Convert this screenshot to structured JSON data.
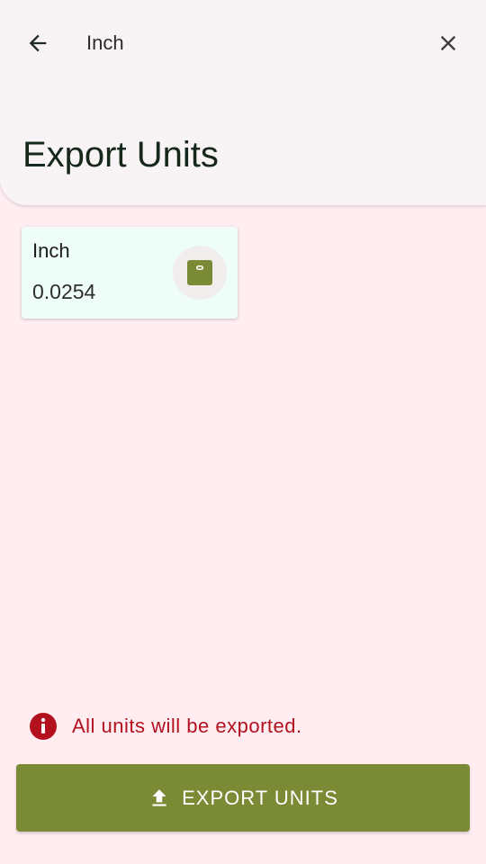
{
  "header": {
    "search_value": "Inch",
    "back_icon": "arrow-left-icon",
    "close_icon": "close-icon",
    "title": "Export Units"
  },
  "units": [
    {
      "name": "Inch",
      "value": "0.0254",
      "toggle_icon": "remove-square-icon"
    }
  ],
  "info": {
    "icon": "info-icon",
    "text": "All units will be exported."
  },
  "export_button": {
    "icon": "upload-icon",
    "label": "EXPORT UNITS"
  },
  "colors": {
    "background": "#ffedf1",
    "header_bg": "#f8f3f4",
    "card_bg": "#effdf8",
    "accent": "#7a8a35",
    "error": "#b3111d"
  }
}
